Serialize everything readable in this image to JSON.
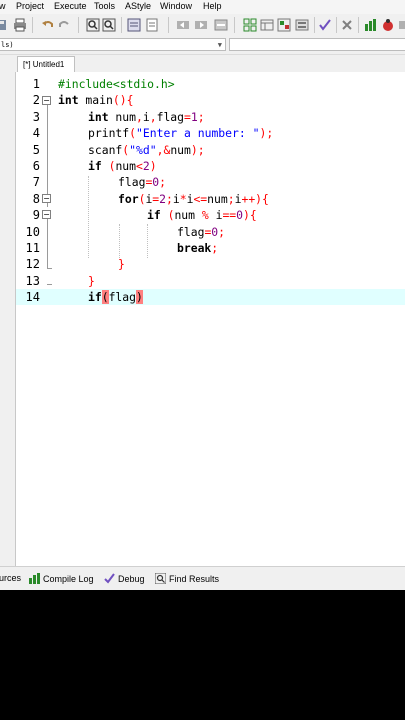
{
  "menu": {
    "items": [
      "w",
      "Project",
      "Execute",
      "Tools",
      "AStyle",
      "Window",
      "Help"
    ]
  },
  "toolbar": {
    "icons": [
      "print-icon",
      "undo-icon",
      "redo-icon",
      "find-icon",
      "replace-icon",
      "goto-icon",
      "indent-icon",
      "unindent-icon",
      "compile-icon",
      "run-icon",
      "compile-run-icon",
      "rebuild-icon",
      "check-icon",
      "close-icon",
      "chart-icon",
      "debug-icon"
    ]
  },
  "combos": {
    "left_value": "ls)"
  },
  "tab": {
    "label": "[*] Untitled1"
  },
  "editor": {
    "current_line": 14,
    "lines": [
      {
        "n": "1"
      },
      {
        "n": "2"
      },
      {
        "n": "3"
      },
      {
        "n": "4"
      },
      {
        "n": "5"
      },
      {
        "n": "6"
      },
      {
        "n": "7"
      },
      {
        "n": "8"
      },
      {
        "n": "9"
      },
      {
        "n": "10"
      },
      {
        "n": "11"
      },
      {
        "n": "12"
      },
      {
        "n": "13"
      },
      {
        "n": "14"
      }
    ],
    "tokens": {
      "l1_pp": "#include<stdio.h>",
      "l2_kw": "int",
      "l2_id": " main",
      "l2_sym": "(){",
      "l3_kw": "int",
      "l3_id1": " num",
      "l3_s1": ",",
      "l3_id2": "i",
      "l3_s2": ",",
      "l3_id3": "flag",
      "l3_s3": "=",
      "l3_num": "1",
      "l3_s4": ";",
      "l4_id": "printf",
      "l4_s1": "(",
      "l4_str": "\"Enter a number: \"",
      "l4_s2": ");",
      "l5_id": "scanf",
      "l5_s1": "(",
      "l5_str": "\"%d\"",
      "l5_s2": ",&",
      "l5_id2": "num",
      "l5_s3": ");",
      "l6_kw": "if",
      "l6_s1": " (",
      "l6_id": "num",
      "l6_s2": "<",
      "l6_num": "2",
      "l6_s3": ")",
      "l7_id": "flag",
      "l7_s1": "=",
      "l7_num": "0",
      "l7_s2": ";",
      "l8_kw": "for",
      "l8_s1": "(",
      "l8_id1": "i",
      "l8_s2": "=",
      "l8_num": "2",
      "l8_s3": ";",
      "l8_id2": "i",
      "l8_s4": "*",
      "l8_id3": "i",
      "l8_s5": "<=",
      "l8_id4": "num",
      "l8_s6": ";",
      "l8_id5": "i",
      "l8_s7": "++){",
      "l9_kw": "if",
      "l9_s1": " (",
      "l9_id1": "num",
      "l9_s2": " % ",
      "l9_id2": "i",
      "l9_s3": "==",
      "l9_num": "0",
      "l9_s4": "){",
      "l10_id": "flag",
      "l10_s1": "=",
      "l10_num": "0",
      "l10_s2": ";",
      "l11_kw": "break",
      "l11_s1": ";",
      "l12_s": "}",
      "l13_s": "}",
      "l14_kw": "if",
      "l14_s1": "(",
      "l14_id": "flag",
      "l14_s2": ")"
    }
  },
  "bottom_tabs": [
    {
      "label": "urces",
      "icon": "resources-icon"
    },
    {
      "label": "Compile Log",
      "icon": "chart-icon"
    },
    {
      "label": "Debug",
      "icon": "check-icon"
    },
    {
      "label": "Find Results",
      "icon": "find-icon"
    }
  ],
  "colors": {
    "keyword": "#000000",
    "preprocessor": "#008000",
    "string": "#0000ff",
    "number": "#800080",
    "symbol": "#ff0000",
    "current_line": "#e0ffff",
    "brace_match": "#ff8080"
  }
}
